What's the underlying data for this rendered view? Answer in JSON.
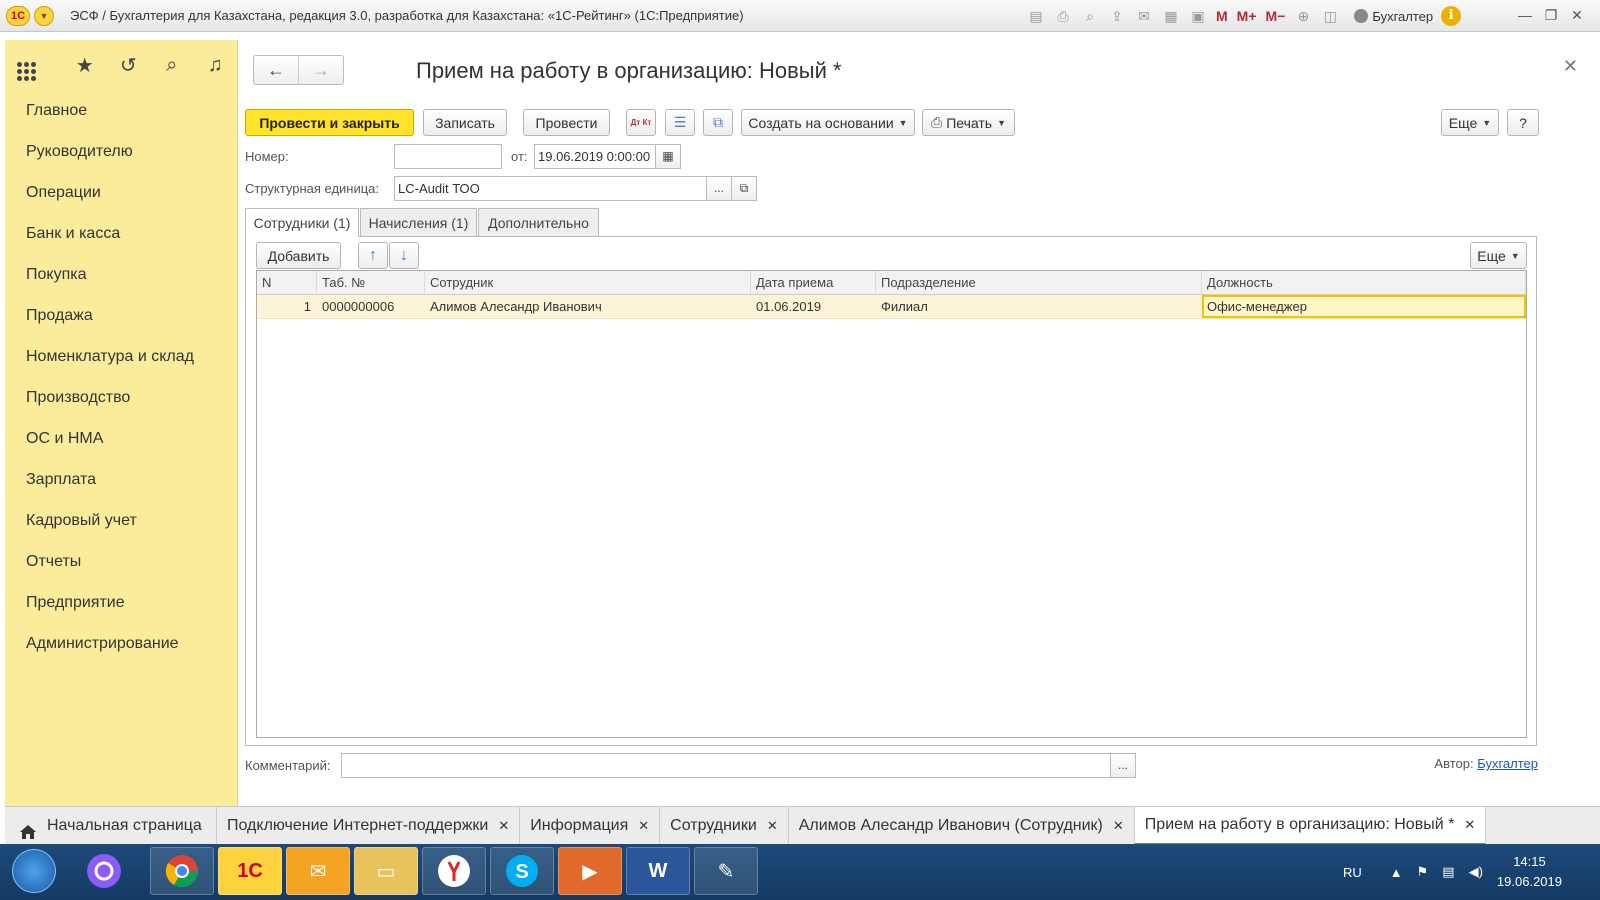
{
  "window": {
    "title": "ЭСФ / Бухгалтерия для Казахстана, редакция 3.0, разработка для Казахстана: «1С-Рейтинг»  (1С:Предприятие)",
    "logo_text": "1С",
    "user_name": "Бухгалтер",
    "info_label": "i",
    "mem_buttons": [
      "M",
      "M+",
      "M−"
    ]
  },
  "sections": {
    "items": [
      "Главное",
      "Руководителю",
      "Операции",
      "Банк и касса",
      "Покупка",
      "Продажа",
      "Номенклатура и склад",
      "Производство",
      "ОС и НМА",
      "Зарплата",
      "Кадровый учет",
      "Отчеты",
      "Предприятие",
      "Администрирование"
    ]
  },
  "form": {
    "title": "Прием на работу в организацию: Новый *",
    "toolbar": {
      "post_close": "Провести и закрыть",
      "save": "Записать",
      "post": "Провести",
      "dtkt": "Дт Кт",
      "create_based": "Создать на основании",
      "print": "Печать",
      "more": "Еще",
      "help": "?"
    },
    "number_label": "Номер:",
    "number_value": "",
    "date_label": "от:",
    "date_value": "19.06.2019  0:00:00",
    "unit_label": "Структурная единица:",
    "unit_value": "LC-Audit ТОО",
    "ellipsis": "...",
    "tabs": [
      "Сотрудники (1)",
      "Начисления (1)",
      "Дополнительно"
    ],
    "table_toolbar": {
      "add": "Добавить",
      "more": "Еще"
    },
    "table": {
      "columns": [
        "N",
        "Таб. №",
        "Сотрудник",
        "Дата приема",
        "Подразделение",
        "Должность"
      ],
      "rows": [
        [
          "1",
          "0000000006",
          "Алимов Алесандр Иванович",
          "01.06.2019",
          "Филиал",
          "Офис-менеджер"
        ]
      ]
    },
    "comment_label": "Комментарий:",
    "comment_value": "",
    "author_label": "Автор:",
    "author_value": "Бухгалтер"
  },
  "open_windows": [
    {
      "label": "Начальная страница",
      "closable": false,
      "active": false
    },
    {
      "label": "Подключение Интернет-поддержки",
      "closable": true,
      "active": false
    },
    {
      "label": "Информация",
      "closable": true,
      "active": false
    },
    {
      "label": "Сотрудники",
      "closable": true,
      "active": false
    },
    {
      "label": "Алимов Алесандр Иванович (Сотрудник)",
      "closable": true,
      "active": false
    },
    {
      "label": "Прием на работу в организацию: Новый *",
      "closable": true,
      "active": true
    }
  ],
  "taskbar": {
    "apps": [
      "alice-icon",
      "chrome-icon",
      "1c-icon",
      "outlook-icon",
      "explorer-icon",
      "yandex-icon",
      "skype-icon",
      "media-icon",
      "word-icon",
      "paint-icon"
    ],
    "lang": "RU",
    "time": "14:15",
    "date": "19.06.2019"
  },
  "colors": {
    "accent": "#ffe42b",
    "panel": "#fbec9c",
    "selection": "#fdf4d8",
    "taskbar": "#1d4a7a"
  }
}
